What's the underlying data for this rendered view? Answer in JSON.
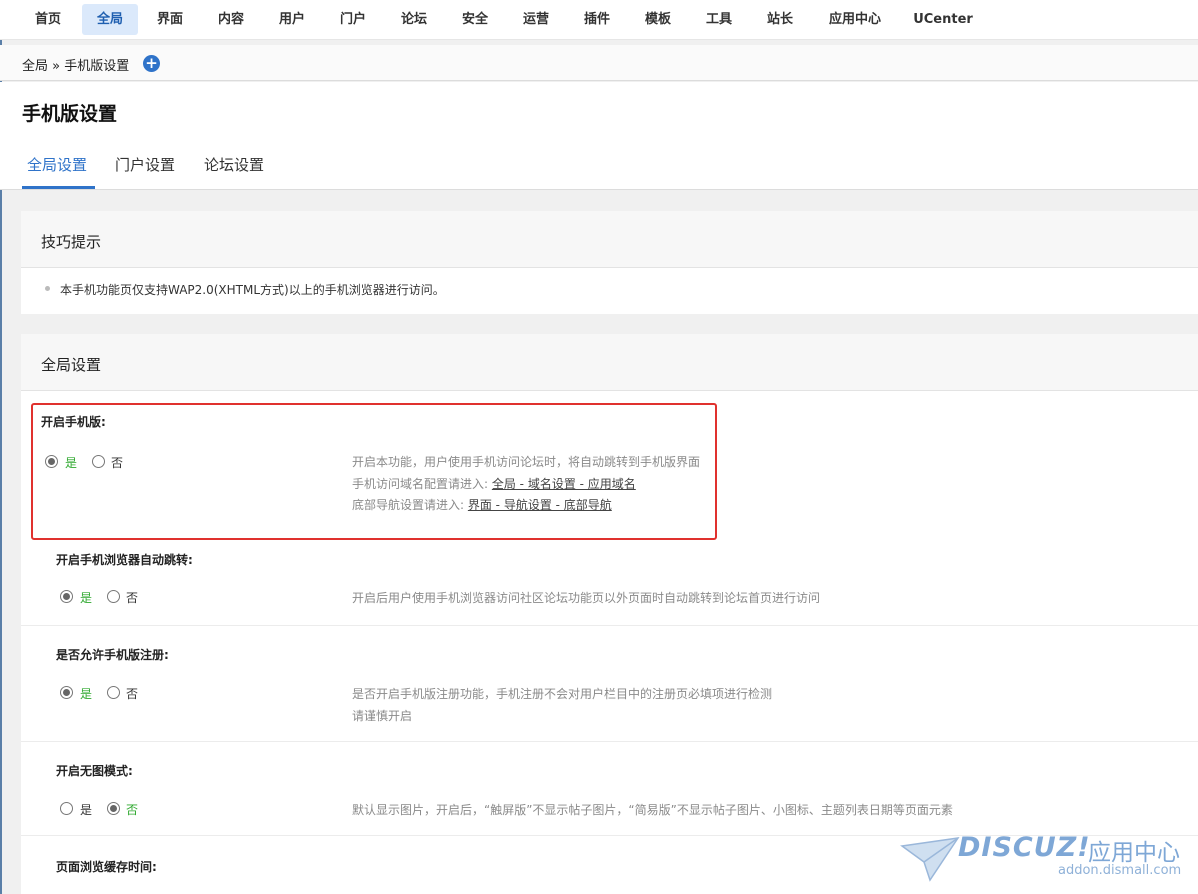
{
  "nav": {
    "items": [
      "首页",
      "全局",
      "界面",
      "内容",
      "用户",
      "门户",
      "论坛",
      "安全",
      "运营",
      "插件",
      "模板",
      "工具",
      "站长",
      "应用中心",
      "UCenter"
    ],
    "active_index": 1
  },
  "breadcrumb": {
    "text": "全局 » 手机版设置",
    "add_icon": "plus-circle-icon"
  },
  "header": {
    "title": "手机版设置",
    "tabs": [
      "全局设置",
      "门户设置",
      "论坛设置"
    ],
    "active_tab": 0
  },
  "tips": {
    "title": "技巧提示",
    "items": [
      "本手机功能页仅支持WAP2.0(XHTML方式)以上的手机浏览器进行访问。"
    ]
  },
  "settings": {
    "title": "全局设置",
    "yes_label": "是",
    "no_label": "否",
    "rows": [
      {
        "label": "开启手机版:",
        "selected": "yes",
        "desc": [
          "开启本功能，用户使用手机访问论坛时，将自动跳转到手机版界面"
        ],
        "desc_line2_prefix": "手机访问域名配置请进入: ",
        "desc_line2_link": "全局 - 域名设置 - 应用域名",
        "desc_line3_prefix": "底部导航设置请进入: ",
        "desc_line3_link": "界面 - 导航设置 - 底部导航"
      },
      {
        "label": "开启手机浏览器自动跳转:",
        "selected": "yes",
        "desc": [
          "开启后用户使用手机浏览器访问社区论坛功能页以外页面时自动跳转到论坛首页进行访问"
        ]
      },
      {
        "label": "是否允许手机版注册:",
        "selected": "yes",
        "desc": [
          "是否开启手机版注册功能，手机注册不会对用户栏目中的注册页必填项进行检测",
          "请谨慎开启"
        ]
      },
      {
        "label": "开启无图模式:",
        "selected": "no",
        "desc": [
          "默认显示图片，开启后，“触屏版”不显示帖子图片，“简易版”不显示帖子图片、小图标、主题列表日期等页面元素"
        ]
      },
      {
        "label": "页面浏览缓存时间:"
      }
    ]
  },
  "watermark": {
    "logo": "DISCUZ!",
    "cn": "应用中心",
    "url": "addon.dismall.com",
    "icon": "paper-plane-icon"
  }
}
